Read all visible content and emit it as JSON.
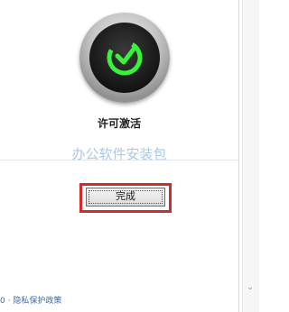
{
  "dialog": {
    "title": "许可激活",
    "watermark": "办公软件安装包",
    "done_label": "完成",
    "footer_prefix": "0 · ",
    "privacy_link": "隐私保护政策"
  },
  "icons": {
    "logo": "activation-check-icon",
    "scroll_down": "chevron-down-icon"
  },
  "colors": {
    "accent_green": "#3df23d",
    "highlight_red": "#d42a2a",
    "link_blue": "#3d6aa8",
    "watermark_blue": "#a9c9e6"
  }
}
